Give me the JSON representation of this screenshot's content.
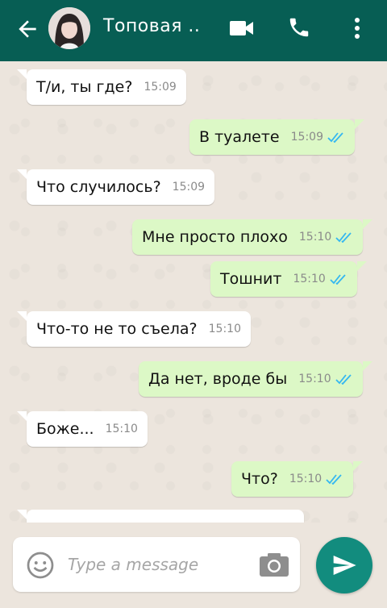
{
  "header": {
    "contact_name": "Топовая ..",
    "back_icon": "arrow-left-icon",
    "video_icon": "video-call-icon",
    "call_icon": "phone-icon",
    "menu_icon": "more-vert-icon"
  },
  "messages": [
    {
      "direction": "incoming",
      "text": "Т/и, ты где?",
      "time": "15:09"
    },
    {
      "direction": "outgoing",
      "text": "В туалете",
      "time": "15:09",
      "status": "read"
    },
    {
      "direction": "incoming",
      "text": "Что случилось?",
      "time": "15:09"
    },
    {
      "direction": "outgoing",
      "text": "Мне просто плохо",
      "time": "15:10",
      "status": "read"
    },
    {
      "direction": "outgoing",
      "text": "Тошнит",
      "time": "15:10",
      "status": "read"
    },
    {
      "direction": "incoming",
      "text": "Что-то не то съела?",
      "time": "15:10"
    },
    {
      "direction": "outgoing",
      "text": "Да нет, вроде бы",
      "time": "15:10",
      "status": "read"
    },
    {
      "direction": "incoming",
      "text": "Боже...",
      "time": "15:10"
    },
    {
      "direction": "outgoing",
      "text": "Что?",
      "time": "15:10",
      "status": "read"
    }
  ],
  "composer": {
    "placeholder": "Type a message",
    "emoji_icon": "emoji-icon",
    "camera_icon": "camera-icon",
    "send_icon": "send-icon"
  },
  "colors": {
    "header": "#075e54",
    "outgoing_bubble": "#dcf8c6",
    "incoming_bubble": "#ffffff",
    "read_ticks": "#34b7f1",
    "send_button": "#128c7e"
  }
}
